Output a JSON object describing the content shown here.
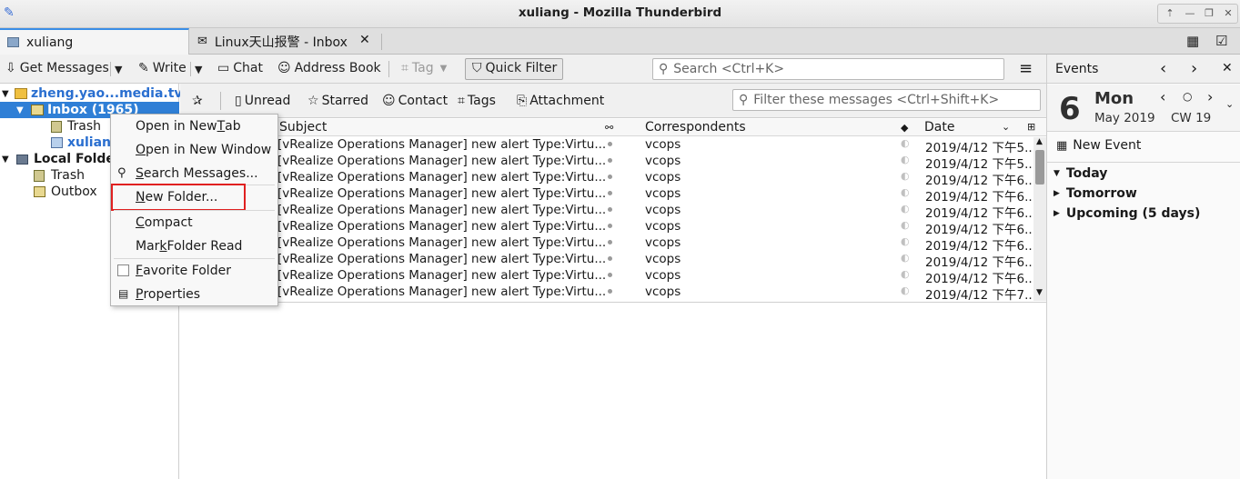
{
  "window": {
    "title": "xuliang - Mozilla Thunderbird"
  },
  "tabs": [
    {
      "label": "xuliang"
    },
    {
      "label": "Linux天山报警 - Inbox"
    }
  ],
  "toolbar": {
    "get_messages": "Get Messages",
    "write": "Write",
    "chat": "Chat",
    "address_book": "Address Book",
    "tag": "Tag",
    "quick_filter": "Quick Filter",
    "search_placeholder": "Search <Ctrl+K>"
  },
  "folders": {
    "account": "zheng.yao...media.tv",
    "inbox": "Inbox (1965)",
    "trash": "Trash",
    "xuliang": "xuliang",
    "local_folders": "Local Folders",
    "local_trash": "Trash",
    "outbox": "Outbox"
  },
  "quick_filter": {
    "unread": "Unread",
    "starred": "Starred",
    "contact": "Contact",
    "tags": "Tags",
    "attachment": "Attachment",
    "filter_placeholder": "Filter these messages <Ctrl+Shift+K>"
  },
  "thread_columns": {
    "subject": "Subject",
    "correspondents": "Correspondents",
    "date": "Date"
  },
  "messages": [
    {
      "subject": "[vRealize Operations Manager] new alert Type:Virtu...",
      "correspondent": "vcops",
      "date": "2019/4/12 下午5..."
    },
    {
      "subject": "[vRealize Operations Manager] new alert Type:Virtu...",
      "correspondent": "vcops",
      "date": "2019/4/12 下午5..."
    },
    {
      "subject": "[vRealize Operations Manager] new alert Type:Virtu...",
      "correspondent": "vcops",
      "date": "2019/4/12 下午6..."
    },
    {
      "subject": "[vRealize Operations Manager] new alert Type:Virtu...",
      "correspondent": "vcops",
      "date": "2019/4/12 下午6..."
    },
    {
      "subject": "[vRealize Operations Manager] new alert Type:Virtu...",
      "correspondent": "vcops",
      "date": "2019/4/12 下午6..."
    },
    {
      "subject": "[vRealize Operations Manager] new alert Type:Virtu...",
      "correspondent": "vcops",
      "date": "2019/4/12 下午6..."
    },
    {
      "subject": "[vRealize Operations Manager] new alert Type:Virtu...",
      "correspondent": "vcops",
      "date": "2019/4/12 下午6..."
    },
    {
      "subject": "[vRealize Operations Manager] new alert Type:Virtu...",
      "correspondent": "vcops",
      "date": "2019/4/12 下午6..."
    },
    {
      "subject": "[vRealize Operations Manager] new alert Type:Virtu...",
      "correspondent": "vcops",
      "date": "2019/4/12 下午6..."
    },
    {
      "subject": "[vRealize Operations Manager] new alert Type:Virtu...",
      "correspondent": "vcops",
      "date": "2019/4/12 下午7..."
    }
  ],
  "context_menu": {
    "open_new_tab": {
      "pre": "Open in New ",
      "key": "T",
      "post": "ab"
    },
    "open_new_window": {
      "pre": "",
      "key": "O",
      "post": "pen in New Window"
    },
    "search_messages": {
      "pre": "",
      "key": "S",
      "post": "earch Messages..."
    },
    "new_folder": {
      "pre": "",
      "key": "N",
      "post": "ew Folder..."
    },
    "compact": {
      "pre": "",
      "key": "C",
      "post": "ompact"
    },
    "mark_folder_read": {
      "pre": "Mar",
      "key": "k",
      "post": " Folder Read"
    },
    "favorite_folder": {
      "pre": "",
      "key": "F",
      "post": "avorite Folder"
    },
    "properties": {
      "pre": "",
      "key": "P",
      "post": "roperties"
    }
  },
  "events": {
    "title": "Events",
    "day_number": "6",
    "weekday": "Mon",
    "month_year": "May 2019",
    "week": "CW 19",
    "new_event": "New Event",
    "today": "Today",
    "tomorrow": "Tomorrow",
    "upcoming": "Upcoming (5 days)"
  },
  "colors": {
    "accent": "#3a8ee6",
    "selected_row": "#2f7fd6",
    "highlight_box": "#e02020"
  }
}
